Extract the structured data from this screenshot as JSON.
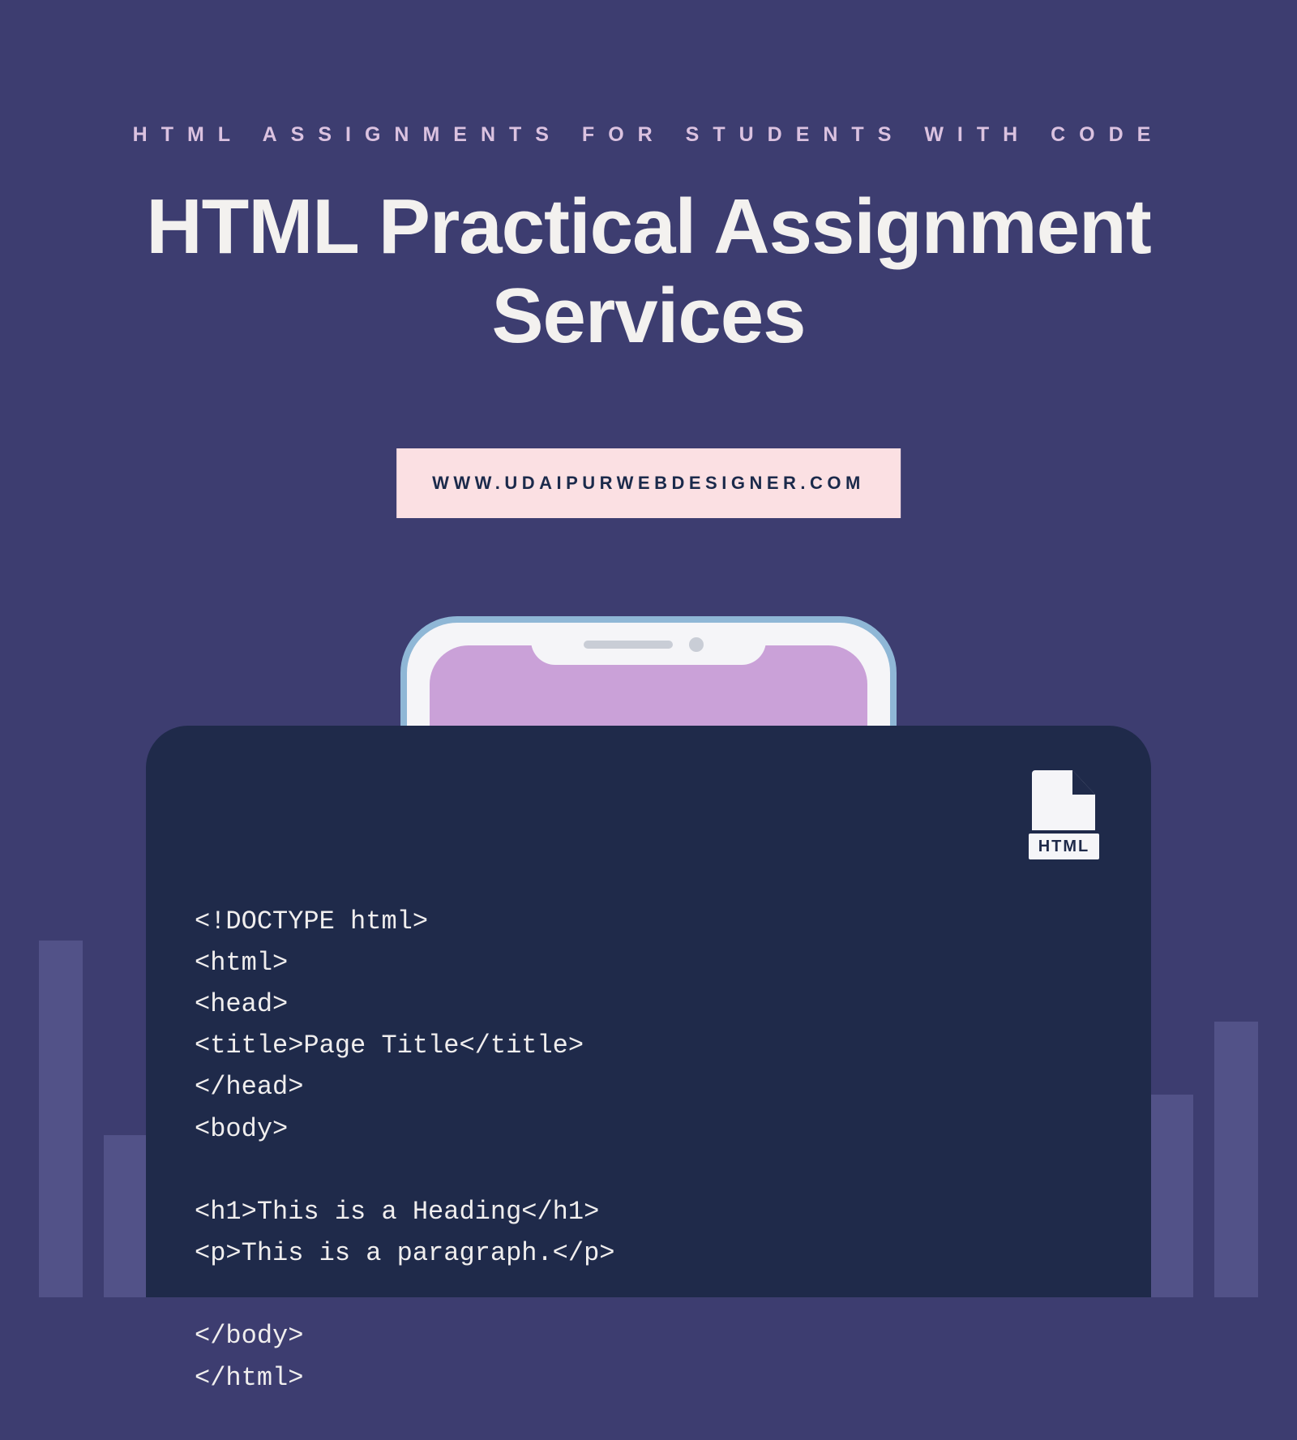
{
  "eyebrow": "HTML ASSIGNMENTS FOR STUDENTS WITH CODE",
  "title_line1": "HTML Practical Assignment",
  "title_line2": "Services",
  "url": "WWW.UDAIPURWEBDESIGNER.COM",
  "file_icon_label": "HTML",
  "code": "<!DOCTYPE html>\n<html>\n<head>\n<title>Page Title</title>\n</head>\n<body>\n\n<h1>This is a Heading</h1>\n<p>This is a paragraph.</p>\n\n</body>\n</html>"
}
